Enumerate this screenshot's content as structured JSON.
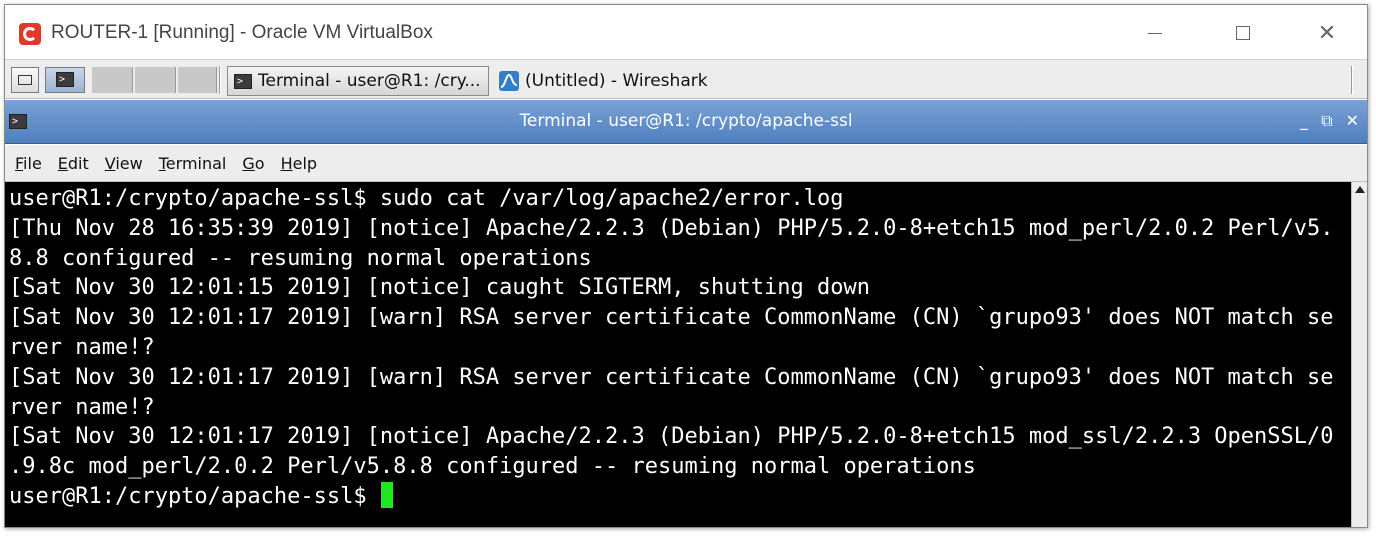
{
  "host_window": {
    "title": "ROUTER-1 [Running] - Oracle VM VirtualBox",
    "icon": "virtualbox-icon",
    "controls": {
      "minimize": "—",
      "maximize": "☐",
      "close": "✕"
    }
  },
  "taskbar": {
    "tasks": [
      {
        "label": "Terminal - user@R1: /cry...",
        "icon": "terminal-icon",
        "active": true
      },
      {
        "label": "(Untitled) - Wireshark",
        "icon": "wireshark-icon",
        "active": false
      }
    ]
  },
  "terminal": {
    "title": "Terminal - user@R1: /crypto/apache-ssl",
    "title_controls": "_ ⧉ ✕",
    "menu": [
      {
        "u": "F",
        "rest": "ile"
      },
      {
        "u": "E",
        "rest": "dit"
      },
      {
        "u": "V",
        "rest": "iew"
      },
      {
        "u": "T",
        "rest": "erminal"
      },
      {
        "u": "G",
        "rest": "o"
      },
      {
        "u": "H",
        "rest": "elp"
      }
    ],
    "lines": [
      "user@R1:/crypto/apache-ssl$ sudo cat /var/log/apache2/error.log",
      "[Thu Nov 28 16:35:39 2019] [notice] Apache/2.2.3 (Debian) PHP/5.2.0-8+etch15 mod_perl/2.0.2 Perl/v5.",
      "8.8 configured -- resuming normal operations",
      "[Sat Nov 30 12:01:15 2019] [notice] caught SIGTERM, shutting down",
      "[Sat Nov 30 12:01:17 2019] [warn] RSA server certificate CommonName (CN) `grupo93' does NOT match se",
      "rver name!?",
      "[Sat Nov 30 12:01:17 2019] [warn] RSA server certificate CommonName (CN) `grupo93' does NOT match se",
      "rver name!?",
      "[Sat Nov 30 12:01:17 2019] [notice] Apache/2.2.3 (Debian) PHP/5.2.0-8+etch15 mod_ssl/2.2.3 OpenSSL/0",
      ".9.8c mod_perl/2.0.2 Perl/v5.8.8 configured -- resuming normal operations"
    ],
    "prompt": "user@R1:/crypto/apache-ssl$ ",
    "colors": {
      "background": "#000000",
      "foreground": "#ffffff",
      "cursor": "#21e621",
      "titlebar": "#5a88c6"
    }
  }
}
